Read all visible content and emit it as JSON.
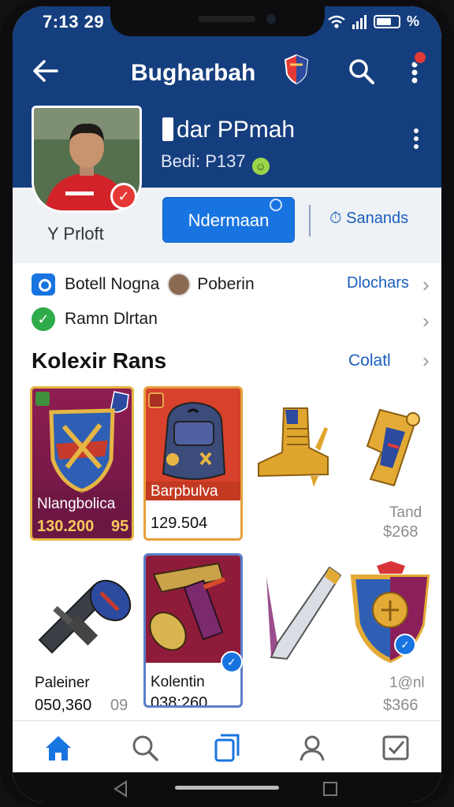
{
  "status": {
    "time": "7:13 29",
    "battery_level": 0.7,
    "battery_pct_symbol": "%"
  },
  "header": {
    "title": "Bugharbah"
  },
  "profile": {
    "name": "dar PPmah",
    "sub": "Bedi: P137",
    "profile_label": "Y Prloft",
    "primary_button": "Ndermaan",
    "secondary_button": "Sanands"
  },
  "rows": [
    {
      "icon": "camera-icon",
      "text": "Botell Nogna",
      "friend": "Poberin",
      "link": "Dlochars"
    },
    {
      "icon": "check-circle-icon",
      "text": "Ramn Dlrtan"
    }
  ],
  "collection": {
    "title": "Kolexir Rans",
    "link": "Colatl",
    "items": [
      {
        "label": "Nlangbolica",
        "value": "130.200",
        "extra": "95",
        "icon": "shield-crest-icon"
      },
      {
        "label": "Barpbulva",
        "value": "129.504",
        "icon": "backpack-icon"
      },
      {
        "label": "",
        "value": "",
        "icon": "golden-boot-icon"
      },
      {
        "label": "Tand",
        "value": "$268",
        "icon": "golden-bracer-icon"
      },
      {
        "label": "Paleiner",
        "value": "050,360",
        "extra": "09",
        "icon": "bazooka-icon"
      },
      {
        "label": "Kolentin",
        "value": "038:260",
        "icon": "blaster-icon"
      },
      {
        "label": "",
        "value": "",
        "icon": "dagger-icon"
      },
      {
        "label": "1@nl",
        "value": "$366",
        "icon": "crest-shield-icon"
      }
    ]
  },
  "nav": [
    "home-icon",
    "search-icon",
    "cards-icon",
    "profile-icon",
    "checklist-icon"
  ],
  "colors": {
    "brand": "#153e7e",
    "accent": "#1874e0",
    "link": "#1a5fbd"
  }
}
